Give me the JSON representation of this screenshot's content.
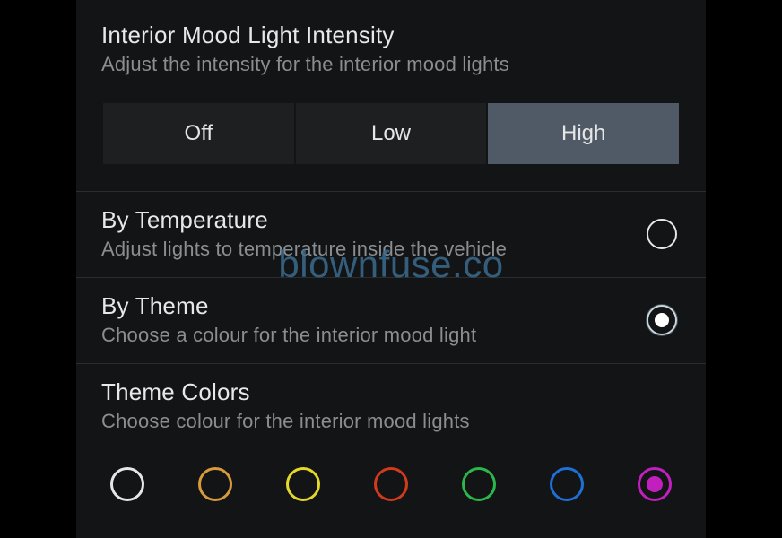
{
  "intensity": {
    "title": "Interior Mood Light Intensity",
    "subtitle": "Adjust the intensity for the interior mood lights",
    "options": {
      "off": "Off",
      "low": "Low",
      "high": "High"
    },
    "selected": "high"
  },
  "byTemperature": {
    "title": "By Temperature",
    "subtitle": "Adjust lights to temperature inside the vehicle",
    "selected": false
  },
  "byTheme": {
    "title": "By Theme",
    "subtitle": "Choose a colour for the interior mood light",
    "selected": true
  },
  "themeColors": {
    "title": "Theme Colors",
    "subtitle": "Choose colour for the interior mood lights",
    "swatches": [
      {
        "name": "white",
        "color": "#e6e6e6",
        "selected": false
      },
      {
        "name": "amber",
        "color": "#d89a3a",
        "selected": false
      },
      {
        "name": "yellow",
        "color": "#e6d82a",
        "selected": false
      },
      {
        "name": "red",
        "color": "#d23a1e",
        "selected": false
      },
      {
        "name": "green",
        "color": "#2bb84a",
        "selected": false
      },
      {
        "name": "blue",
        "color": "#1e6fd6",
        "selected": false
      },
      {
        "name": "magenta",
        "color": "#c21fbf",
        "selected": true
      }
    ]
  },
  "watermark": "blownfuse.co"
}
